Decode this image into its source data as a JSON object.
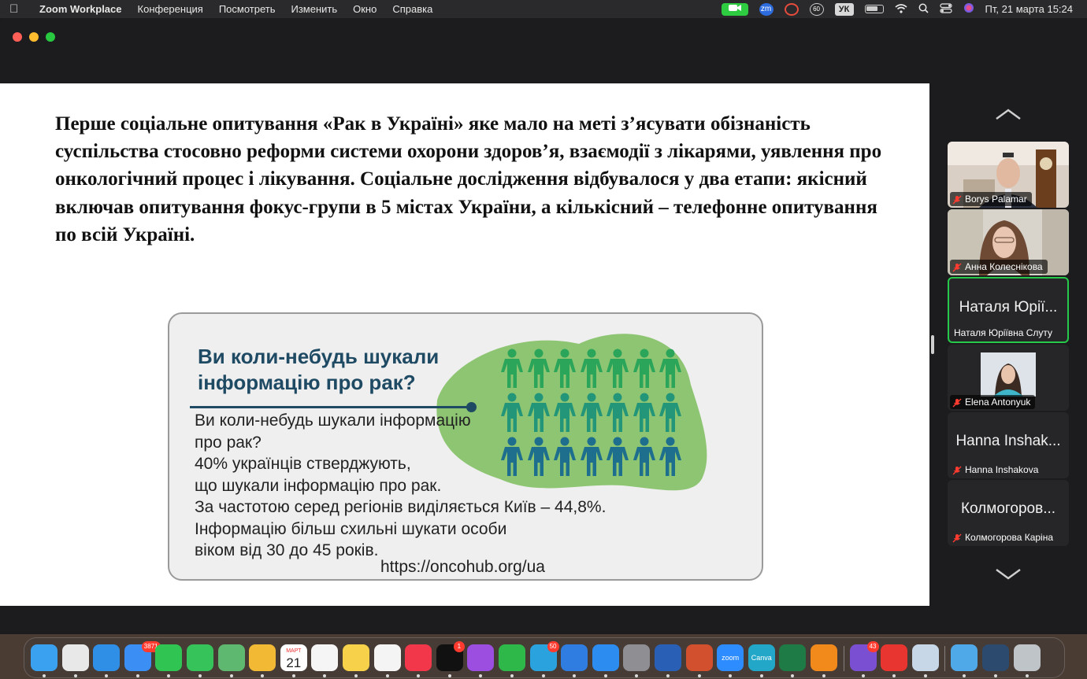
{
  "menubar": {
    "app_name": "Zoom Workplace",
    "menus": [
      "Конференция",
      "Посмотреть",
      "Изменить",
      "Окно",
      "Справка"
    ],
    "keyboard_layout": "УК",
    "clock": "Пт, 21 марта  15:24",
    "zoom_badge": "zm",
    "vpn_badge": "60"
  },
  "slide": {
    "paragraph": "Перше соціальне опитування «Рак в Україні» яке мало на меті з’ясувати обізнаність суспільства стосовно реформи системи охорони здоров’я, взаємодії з лікарями, уявлення про онкологічний процес і лікування. Соціальне дослідження відбувалося у два етапи: якісний включав опитування фокус-групи в 5 містах України, а кількісний – телефонне опитування по всій Україні.",
    "infographic": {
      "title": "Ви коли-небудь шукали інформацію про рак?",
      "body": [
        "Ви коли-небудь шукали інформацію",
        "про рак?",
        "40% українців стверджують,",
        "що шукали інформацію про рак.",
        "За частотою серед регіонів виділяється Київ – 44,8%.",
        "Інформацію більш схильні шукати особи",
        "віком від 30 до 45 років."
      ],
      "link": "https://oncohub.org/ua",
      "colors": {
        "title": "#1f4a63",
        "blob": "#8dc572",
        "people_top": "#2aa55a",
        "people_mid": "#23967a",
        "people_bottom": "#1e6e8e"
      }
    }
  },
  "participants": [
    {
      "name": "Borys Palamar",
      "video": true,
      "muted": true
    },
    {
      "name": "Анна Колеснікова",
      "video": true,
      "muted": true
    },
    {
      "display_name": "Наталя Юрії...",
      "name": "Наталя Юріївна Слуту",
      "video": false,
      "muted": false,
      "active": true
    },
    {
      "name": "Elena Antonyuk",
      "video": true,
      "muted": true
    },
    {
      "display_name": "Hanna Inshak...",
      "name": "Hanna Inshakova",
      "video": false,
      "muted": true
    },
    {
      "display_name": "Колмогоров...",
      "name": "Колмогорова Каріна",
      "video": false,
      "muted": true
    }
  ],
  "dock": {
    "apps": [
      {
        "name": "finder-icon",
        "color": "#3aa0f0"
      },
      {
        "name": "launchpad-icon",
        "color": "#e8e8e8"
      },
      {
        "name": "safari-icon",
        "color": "#2f8fe6"
      },
      {
        "name": "mail-icon",
        "color": "#3b8ef3",
        "badge": "3871"
      },
      {
        "name": "facetime-icon",
        "color": "#30c552"
      },
      {
        "name": "messages-icon",
        "color": "#35c35a"
      },
      {
        "name": "maps-icon",
        "color": "#5fb870"
      },
      {
        "name": "photos-icon",
        "color": "#f2b935"
      },
      {
        "name": "calendar-icon",
        "color": "#ffffff",
        "month": "МАРТ",
        "day": "21"
      },
      {
        "name": "reminders-icon",
        "color": "#f5f5f5"
      },
      {
        "name": "notes-icon",
        "color": "#f7d14a"
      },
      {
        "name": "freeform-icon",
        "color": "#f4f4f4"
      },
      {
        "name": "music-icon",
        "color": "#f2374a"
      },
      {
        "name": "apple-tv-icon",
        "color": "#111111",
        "badge": "1"
      },
      {
        "name": "podcasts-icon",
        "color": "#9b4ee0"
      },
      {
        "name": "numbers-icon",
        "color": "#2fb84a"
      },
      {
        "name": "telegram-icon",
        "color": "#2aa2de",
        "badge": "50"
      },
      {
        "name": "keynote-icon",
        "color": "#2f7de0"
      },
      {
        "name": "app-store-icon",
        "color": "#2d8cf0"
      },
      {
        "name": "system-settings-icon",
        "color": "#8e8e93"
      },
      {
        "name": "word-icon",
        "color": "#2a5fb6"
      },
      {
        "name": "powerpoint-icon",
        "color": "#d2502e"
      },
      {
        "name": "zoom-icon",
        "color": "#2d8cff",
        "label": "zoom"
      },
      {
        "name": "canva-icon",
        "color": "#22a7c8",
        "label": "Canva"
      },
      {
        "name": "excel-icon",
        "color": "#1f7b45"
      },
      {
        "name": "vlc-icon",
        "color": "#f28a1b"
      },
      {
        "name": "viber-icon",
        "color": "#7b4fd1",
        "badge": "43"
      },
      {
        "name": "anydesk-icon",
        "color": "#e8352f"
      },
      {
        "name": "preview-icon",
        "color": "#c7d7e8"
      },
      {
        "name": "downloads-folder-icon",
        "color": "#4fa9e8"
      },
      {
        "name": "screenshot-stack-icon",
        "color": "#2c4a6e"
      },
      {
        "name": "trash-icon",
        "color": "#bfc4c8"
      }
    ]
  }
}
